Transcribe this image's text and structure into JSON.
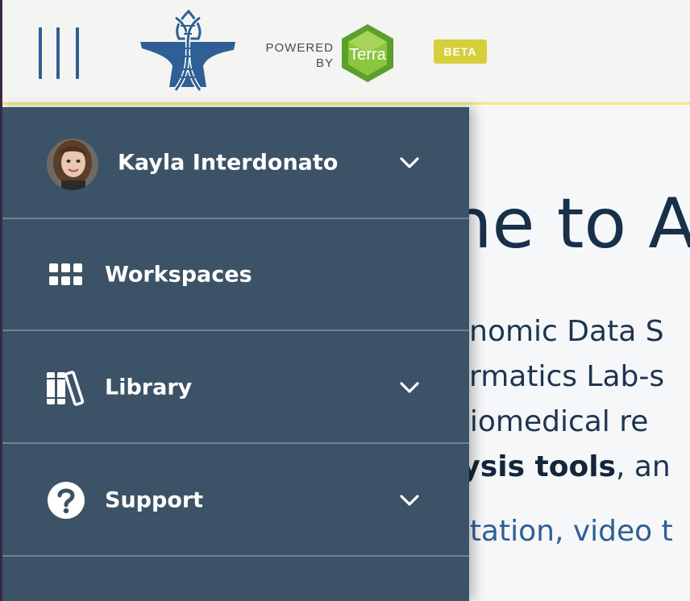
{
  "header": {
    "powered_line1": "POWERED",
    "powered_line2": "BY",
    "terra_text": "Terra",
    "beta_label": "BETA",
    "colors": {
      "menu_bars": "#2f5f94",
      "beta": "#d6cf3a",
      "terra_green": "#8cc63f",
      "header_border": "#f0e97a"
    }
  },
  "drawer": {
    "user_name": "Kayla Interdonato",
    "items": [
      {
        "label": "Workspaces",
        "icon": "grid-icon"
      },
      {
        "label": "Library",
        "icon": "library-icon"
      },
      {
        "label": "Support",
        "icon": "question-circle-icon"
      }
    ],
    "colors": {
      "background": "#3c5266",
      "divider": "#6f8293"
    }
  },
  "main": {
    "title_fragment": "ne to A",
    "lines": [
      "enomic Data S",
      "ormatics Lab-s",
      "biomedical re"
    ],
    "line4_bold": "lysis tools",
    "line4_rest": ", an",
    "link_fragment": "ntation, video t"
  }
}
